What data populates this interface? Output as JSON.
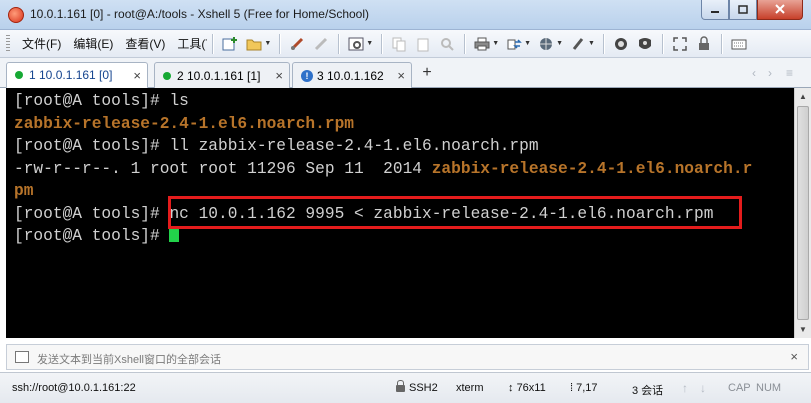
{
  "window": {
    "title": "10.0.1.161 [0] - root@A:/tools - Xshell 5 (Free for Home/School)",
    "icon": "xshell-logo-icon"
  },
  "menu": {
    "items": [
      "文件(F)",
      "编辑(E)",
      "查看(V)",
      "工具(T)"
    ]
  },
  "toolbar": {
    "icons": [
      "new-session-icon",
      "open-folder-icon",
      "reconnect-icon",
      "disconnect-icon",
      "properties-icon",
      "copy-icon",
      "paste-icon",
      "find-icon",
      "print-icon",
      "transfer-icon",
      "globe-icon",
      "highlight-icon",
      "xftp-icon",
      "xmanager-icon",
      "fullscreen-icon",
      "keyboard-icon"
    ]
  },
  "tabs": [
    {
      "label": "1 10.0.1.161 [0]",
      "status": "connected",
      "active": true
    },
    {
      "label": "2 10.0.1.161 [1]",
      "status": "connected",
      "active": false
    },
    {
      "label": "3 10.0.1.162",
      "status": "warning",
      "active": false
    }
  ],
  "terminal": {
    "lines": [
      {
        "prompt": "[root@A tools]# ",
        "cmd": "ls"
      },
      {
        "output_highlight": "zabbix-release-2.4-1.el6.noarch.rpm"
      },
      {
        "prompt": "[root@A tools]# ",
        "cmd": "ll zabbix-release-2.4-1.el6.noarch.rpm"
      },
      {
        "output": "-rw-r--r--. 1 root root 11296 Sep 11  2014 ",
        "output_highlight": "zabbix-release-2.4-1.el6.noarch.r"
      },
      {
        "output_highlight": "pm"
      },
      {
        "prompt": "[root@A tools]# ",
        "cmd": "nc 10.0.1.162 9995 < zabbix-release-2.4-1.el6.noarch.rpm"
      },
      {
        "prompt": "[root@A tools]# ",
        "cmd": ""
      }
    ],
    "colors": {
      "background": "#000000",
      "text": "#d0d0d0",
      "highlight": "#b7742a",
      "cursor": "#22d24a",
      "annotation_box": "#e41c1c"
    }
  },
  "compose": {
    "placeholder": "发送文本到当前Xshell窗口的全部会话"
  },
  "statusbar": {
    "connection": "ssh://root@10.0.1.161:22",
    "protocol": "SSH2",
    "terminal_type": "xterm",
    "size": "76x11",
    "cursor_pos": "7,17",
    "sessions": "3 会话",
    "caps": "CAP",
    "num": "NUM"
  }
}
